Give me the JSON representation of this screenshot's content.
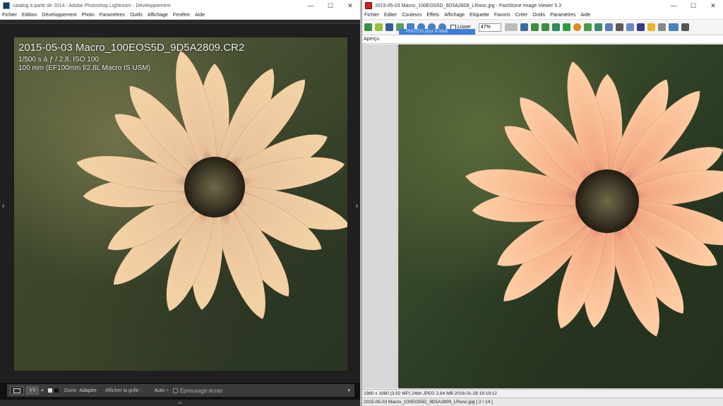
{
  "lightroom": {
    "title": "catalog à partir de 2014 - Adobe Photoshop Lightroom - Développement",
    "menu": [
      "Fichier",
      "Edition",
      "Développement",
      "Photo",
      "Paramètres",
      "Outils",
      "Affichage",
      "Fenêtre",
      "Aide"
    ],
    "photo_info": {
      "filename": "2015-05-03 Macro_100EOS5D_9D5A2809.CR2",
      "exposure": "1/500 s à ƒ / 2,8, ISO 100",
      "lens": "100 mm (EF100mm f/2.8L Macro IS USM)"
    },
    "toolbar": {
      "view_yy": "YY",
      "zoom_label": "Zoom",
      "zoom_value": "Adapter",
      "grid_label": "Afficher la grille :",
      "grid_value": "Auto",
      "softproof_label": "Epreuvage écran"
    }
  },
  "faststone": {
    "title": "2015-05-03 Macro_100EOS5D_9D5A2809_LRwsc.jpg - FastStone Image Viewer 5.3",
    "menu": [
      "Fichier",
      "Editer",
      "Couleurs",
      "Effets",
      "Affichage",
      "Etiquette",
      "Favoris",
      "Créer",
      "Outils",
      "Paramètres",
      "Aide"
    ],
    "smooth_label": "Lisser",
    "zoom_value": "47%",
    "tree_item": "PHOTOS pour le Web",
    "preview_label": "Aperçu",
    "status_info": "1980 x 1980 (3.92 MP)  24bit  JPEG  2.84 MB   2016-01-28 19:19:12",
    "status_file": "2015-05-03 Macro_100EOS5D_9D5A2809_LRwsc.jpg [ 2 / 14 ]"
  },
  "window_buttons": {
    "minimize": "—",
    "maximize": "☐",
    "close": "✕"
  },
  "colors": {
    "lr_dark": "#111111",
    "fs_selection": "#3d7ed8",
    "petal": "#f1c79a"
  }
}
